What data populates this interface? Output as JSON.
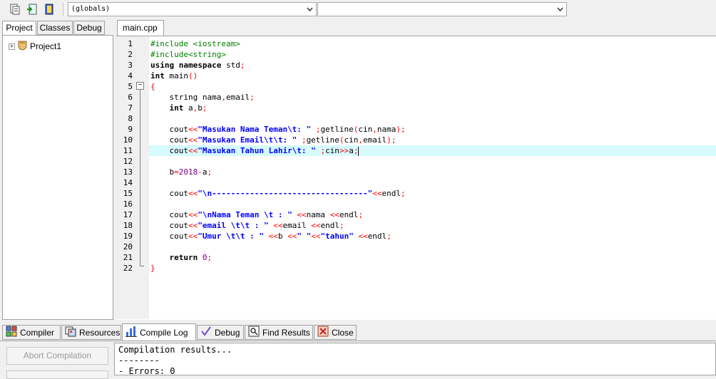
{
  "toolbar": {
    "buttons": [
      "new-file-icon",
      "add-file-icon",
      "project-options-icon"
    ],
    "scope_combo": "(globals)",
    "member_combo": ""
  },
  "left_tabs": [
    "Project",
    "Classes",
    "Debug"
  ],
  "project_tree": {
    "root": "Project1"
  },
  "editor": {
    "tab": "main.cpp",
    "current_line": 11,
    "line_numbers": [
      "1",
      "2",
      "3",
      "4",
      "5",
      "6",
      "7",
      "8",
      "9",
      "10",
      "11",
      "12",
      "13",
      "14",
      "15",
      "16",
      "17",
      "18",
      "19",
      "20",
      "21",
      "22"
    ]
  },
  "bottom_tabs": [
    "Compiler",
    "Resources",
    "Compile Log",
    "Debug",
    "Find Results",
    "Close"
  ],
  "compile": {
    "abort_label": "Abort Compilation",
    "log": [
      "Compilation results...",
      "--------",
      "- Errors: 0"
    ]
  }
}
